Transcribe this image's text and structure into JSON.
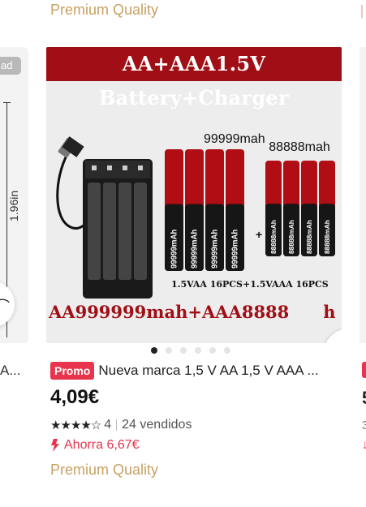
{
  "top": {
    "quality_label": "Premium Quality"
  },
  "left_card": {
    "ad_label": "ad",
    "dimension_label": "1.96in",
    "title_fragment": "A..."
  },
  "main_card": {
    "image": {
      "banner_text": "AA+AAA1.5V Battery+Charger",
      "left_capacity": "99999mah",
      "right_capacity": "88888mah",
      "cell_text_left": "99999mAh",
      "cell_text_right": "88888mAh",
      "pcs_text": "1.5VAA 16PCS+1.5VAAA 16PCS",
      "bottom_text": "AA999999mah+AAA8888",
      "bottom_text_tail": "h",
      "plus_sign": "+"
    },
    "carousel": {
      "count": 6,
      "active_index": 0
    },
    "promo_badge": "Promo",
    "title": "Nueva marca 1,5 V AA 1,5 V AAA ...",
    "price": "4,09€",
    "rating": {
      "stars_filled": 4,
      "stars_total": 5,
      "value": "4",
      "sold": "24 vendidos",
      "stars_text": "★★★★☆"
    },
    "saving": "Ahorra 6,67€",
    "quality_label": "Premium Quality",
    "colors": {
      "accent_red": "#e8344d",
      "banner_red": "#a00f16",
      "gold": "#c9a063"
    }
  },
  "right_card": {
    "price_fragment": "5",
    "rating_fragment": "3",
    "saving_fragment": "↓"
  }
}
